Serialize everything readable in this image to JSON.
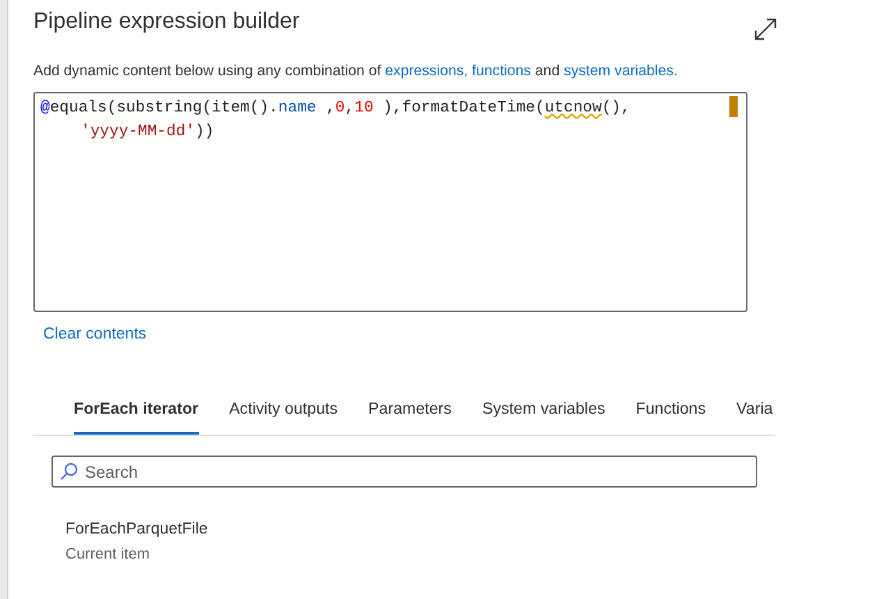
{
  "dialog": {
    "title": "Pipeline expression builder",
    "description": [
      {
        "text": "Add dynamic content below using any combination of ",
        "link": false
      },
      {
        "text": "expressions, functions",
        "link": true
      },
      {
        "text": " and ",
        "link": false
      },
      {
        "text": "system variables.",
        "link": true
      }
    ],
    "editor": {
      "lines": [
        [
          {
            "text": "@",
            "kind": "at"
          },
          {
            "text": "equals(substring(item().",
            "kind": "plain"
          },
          {
            "text": "name",
            "kind": "property"
          },
          {
            "text": " ,",
            "kind": "plain"
          },
          {
            "text": "0",
            "kind": "number"
          },
          {
            "text": ",",
            "kind": "plain"
          },
          {
            "text": "10",
            "kind": "number"
          },
          {
            "text": " ),formatDateTime(",
            "kind": "plain"
          },
          {
            "text": "utcnow",
            "kind": "flagged"
          },
          {
            "text": "(),",
            "kind": "plain"
          }
        ],
        [
          {
            "text": "'yyyy-MM-dd'",
            "kind": "string"
          },
          {
            "text": "))",
            "kind": "plain"
          }
        ]
      ]
    },
    "clear_link": "Clear contents",
    "tabs": [
      {
        "label": "ForEach iterator",
        "selected": true
      },
      {
        "label": "Activity outputs",
        "selected": false
      },
      {
        "label": "Parameters",
        "selected": false
      },
      {
        "label": "System variables",
        "selected": false
      },
      {
        "label": "Functions",
        "selected": false
      },
      {
        "label": "Varia",
        "selected": false
      }
    ],
    "search": {
      "placeholder": "Search"
    },
    "items": [
      {
        "name": "ForEachParquetFile",
        "description": "Current item"
      }
    ]
  }
}
